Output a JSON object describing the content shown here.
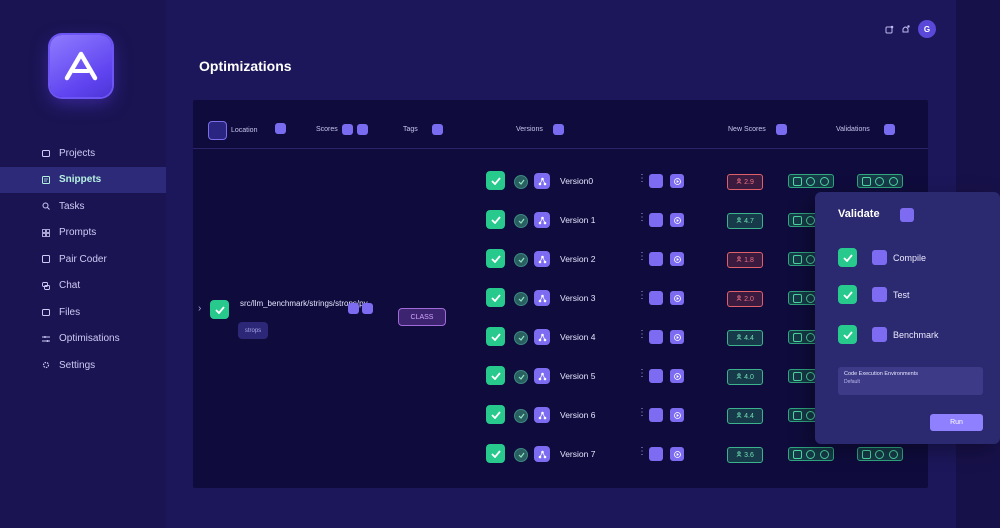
{
  "page": {
    "title": "Optimizations"
  },
  "user": {
    "avatar_initial": "G"
  },
  "sidebar": {
    "items": [
      {
        "label": "Projects",
        "icon": "folder-icon"
      },
      {
        "label": "Snippets",
        "icon": "snippet-icon",
        "active": true
      },
      {
        "label": "Tasks",
        "icon": "search-icon"
      },
      {
        "label": "Prompts",
        "icon": "grid-icon"
      },
      {
        "label": "Pair Coder",
        "icon": "code-icon"
      },
      {
        "label": "Chat",
        "icon": "chat-icon"
      },
      {
        "label": "Files",
        "icon": "folder-icon"
      },
      {
        "label": "Optimisations",
        "icon": "sliders-icon"
      },
      {
        "label": "Settings",
        "icon": "gear-icon"
      }
    ]
  },
  "table": {
    "headers": {
      "location": "Location",
      "scores": "Scores",
      "tags": "Tags",
      "versions": "Versions",
      "new_scores": "New Scores",
      "validations": "Validations"
    },
    "snippet": {
      "path": "src/llm_benchmark/strings/strops/py",
      "tag": "strops",
      "type_badge": "CLASS"
    },
    "versions": [
      {
        "label": "Version0",
        "score": "2.9",
        "status": "bad"
      },
      {
        "label": "Version 1",
        "score": "4.7",
        "status": "good"
      },
      {
        "label": "Version 2",
        "score": "1.8",
        "status": "bad"
      },
      {
        "label": "Version 3",
        "score": "2.0",
        "status": "bad"
      },
      {
        "label": "Version 4",
        "score": "4.4",
        "status": "good"
      },
      {
        "label": "Version 5",
        "score": "4.0",
        "status": "good"
      },
      {
        "label": "Version 6",
        "score": "4.4",
        "status": "good"
      },
      {
        "label": "Version 7",
        "score": "3.6",
        "status": "good"
      }
    ]
  },
  "validate_popup": {
    "title": "Validate",
    "options": [
      {
        "label": "Compile",
        "checked": true
      },
      {
        "label": "Test",
        "checked": true
      },
      {
        "label": "Benchmark",
        "checked": true
      }
    ],
    "env_label": "Code Execution Environments",
    "env_value": "Default",
    "run_label": "Run"
  },
  "colors": {
    "accent": "#7d6cf2",
    "success": "#27c98d",
    "danger": "#e0606a",
    "background": "#17114a"
  }
}
